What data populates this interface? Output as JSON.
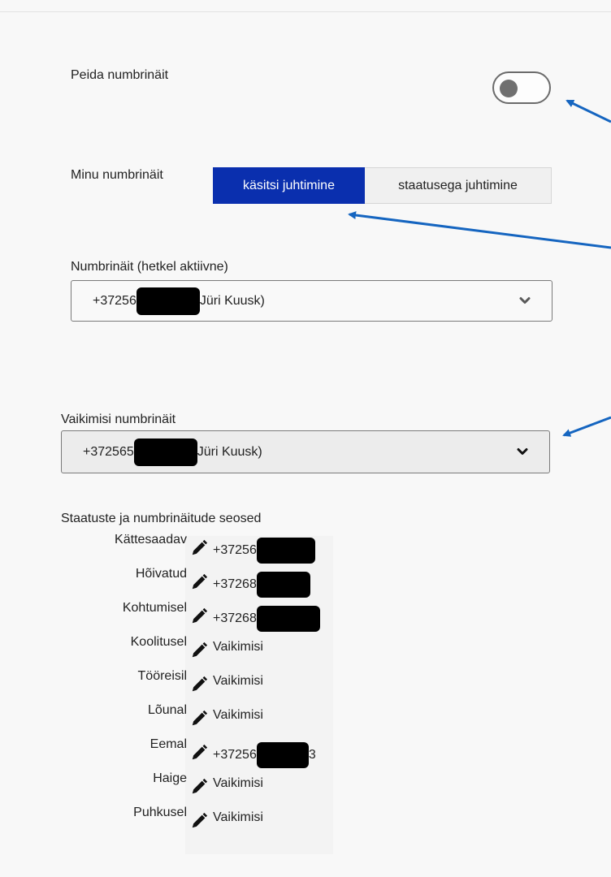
{
  "settings": {
    "hide_number_label": "Peida numbrinäit",
    "hide_number_on": false,
    "my_number_label": "Minu numbrinäit",
    "mode_options": [
      "käsitsi juhtimine",
      "staatusega juhtimine"
    ],
    "mode_selected": "käsitsi juhtimine",
    "active_number": {
      "label": "Numbrinäit (hetkel aktiivne)",
      "prefix": "+37256",
      "suffix": "Jüri Kuusk)"
    },
    "default_number": {
      "label": "Vaikimisi numbrinäit",
      "prefix": "+372565",
      "suffix": "Jüri Kuusk)"
    }
  },
  "mapping": {
    "title": "Staatuste ja numbrinäitude seosed",
    "rows": [
      {
        "status": "Kättesaadav",
        "value": "+37256",
        "tail": ""
      },
      {
        "status": "Hõivatud",
        "value": "+37268",
        "tail": ""
      },
      {
        "status": "Kohtumisel",
        "value": "+37268",
        "tail": ""
      },
      {
        "status": "Koolitusel",
        "value": "Vaikimisi",
        "tail": ""
      },
      {
        "status": "Tööreisil",
        "value": "Vaikimisi",
        "tail": ""
      },
      {
        "status": "Lõunal",
        "value": "Vaikimisi",
        "tail": ""
      },
      {
        "status": "Eemal",
        "value": "+37256",
        "tail": "3"
      },
      {
        "status": "Haige",
        "value": "Vaikimisi",
        "tail": ""
      },
      {
        "status": "Puhkusel",
        "value": "Vaikimisi",
        "tail": ""
      }
    ]
  },
  "colors": {
    "accent": "#0a2fae",
    "arrow": "#1565c0"
  }
}
